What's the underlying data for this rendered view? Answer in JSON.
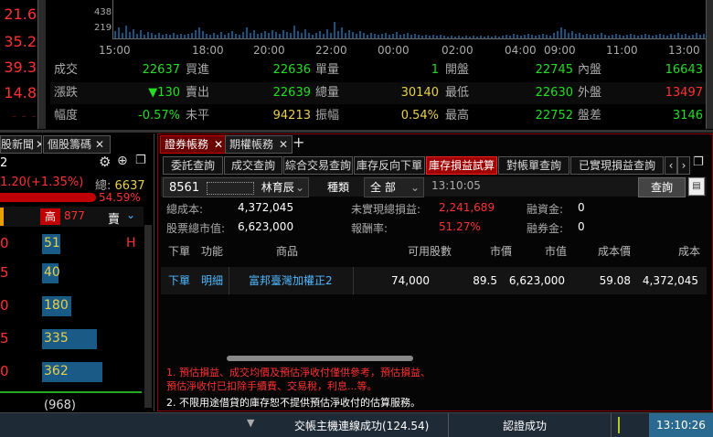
{
  "chart": {
    "yticks": [
      "438",
      "219"
    ],
    "xticks": [
      "15:00",
      "18:00",
      "20:00",
      "22:00",
      "00:00",
      "02:00",
      "04:00",
      "09:00",
      "11:00",
      "13:00"
    ]
  },
  "left_prices": [
    "21.6",
    "35.2",
    "39.3",
    "14.8"
  ],
  "stats": {
    "row1": {
      "l1": "成交",
      "v1": "22637",
      "l2": "買進",
      "v2": "22636",
      "l3": "單量",
      "v3": "1",
      "l4": "開盤",
      "v4": "22745",
      "l5": "內盤",
      "v5": "16643"
    },
    "row2": {
      "l1": "漲跌",
      "v1": "▼130",
      "l2": "賣出",
      "v2": "22639",
      "l3": "總量",
      "v3": "30140",
      "l4": "最低",
      "v4": "22630",
      "l5": "外盤",
      "v5": "13497"
    },
    "row3": {
      "l1": "幅度",
      "v1": "-0.57%",
      "l2": "未平",
      "v2": "94213",
      "l3": "振幅",
      "v3": "0.54%",
      "l4": "最高",
      "v4": "22752",
      "l5": "盤差",
      "v5": "3146"
    }
  },
  "left_panel": {
    "tab1": "股新聞",
    "tab2": "個股籌碼",
    "code": "2",
    "total_label": "總:",
    "total": "6637",
    "change": "1.20(+1.35%)",
    "pct": "54.59%",
    "high_label": "高",
    "high_val": "877",
    "sell_label": "賣",
    "rows": [
      {
        "left": "0",
        "val": "51",
        "tag": "H"
      },
      {
        "left": "5",
        "val": "40",
        "tag": ""
      },
      {
        "left": "0",
        "val": "180",
        "tag": ""
      },
      {
        "left": "5",
        "val": "335",
        "tag": ""
      },
      {
        "left": "0",
        "val": "362",
        "tag": ""
      }
    ],
    "bottom": "(968)"
  },
  "tabs": {
    "t1": "證券帳務",
    "t2": "期權帳務",
    "add": "+"
  },
  "subtabs": [
    "委託查詢",
    "成交查詢",
    "綜合交易查詢",
    "庫存反向下單",
    "庫存損益試算",
    "對帳單查詢",
    "已實現損益查詢"
  ],
  "account": {
    "id": "8561",
    "name": "林育辰",
    "type_label": "種類",
    "type_value": "全 部",
    "time": "13:10:05",
    "query_btn": "查詢"
  },
  "summary": {
    "cost_label": "總成本:",
    "cost": "4,372,045",
    "unreal_label": "未實現總損益:",
    "unreal": "2,241,689",
    "margin_label": "融資金:",
    "margin": "0",
    "mv_label": "股票總市值:",
    "mv": "6,623,000",
    "roi_label": "報酬率:",
    "roi": "51.27%",
    "short_label": "融券金:",
    "short": "0"
  },
  "table": {
    "headers": [
      "下單",
      "功能",
      "商品",
      "可用股數",
      "市價",
      "市值",
      "成本價",
      "成本"
    ],
    "row": [
      "下單",
      "明細",
      "富邦臺灣加權正2",
      "74,000",
      "89.5",
      "6,623,000",
      "59.08",
      "4,372,045"
    ]
  },
  "notes": {
    "n1a": "1. 預估損益、成交均價及預估淨收付僅供參考，預估損益、",
    "n1b": "預估淨收付已扣除手續費、交易稅，利息...等。",
    "n2": "2. 不限用途借貸的庫存恕不提供預估淨收付的估算服務。"
  },
  "status": {
    "conn": "交帳主機連線成功(124.54)",
    "auth": "認證成功",
    "clock": "13:10:26"
  }
}
